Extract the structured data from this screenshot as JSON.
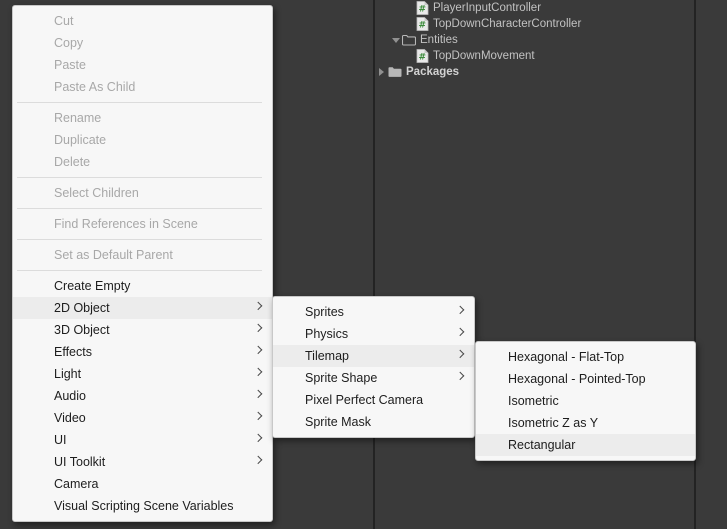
{
  "project_tree": {
    "rows": [
      {
        "label": "PlayerInputController",
        "icon": "csharp-script-icon",
        "indent": 2,
        "twisty": "none",
        "bold": false
      },
      {
        "label": "TopDownCharacterController",
        "icon": "csharp-script-icon",
        "indent": 2,
        "twisty": "none",
        "bold": false
      },
      {
        "label": "Entities",
        "icon": "folder-open-icon",
        "indent": 1,
        "twisty": "expanded",
        "bold": false
      },
      {
        "label": "TopDownMovement",
        "icon": "csharp-script-icon",
        "indent": 2,
        "twisty": "none",
        "bold": false
      },
      {
        "label": "Packages",
        "icon": "folder-icon",
        "indent": 0,
        "twisty": "collapsed",
        "bold": true
      }
    ]
  },
  "menus": {
    "create_menu": {
      "name": "GameObject context menu",
      "items": [
        {
          "label": "Cut",
          "disabled": true,
          "submenu": false,
          "highlight": false
        },
        {
          "label": "Copy",
          "disabled": true,
          "submenu": false,
          "highlight": false
        },
        {
          "label": "Paste",
          "disabled": true,
          "submenu": false,
          "highlight": false
        },
        {
          "label": "Paste As Child",
          "disabled": true,
          "submenu": false,
          "highlight": false
        },
        {
          "separator": true
        },
        {
          "label": "Rename",
          "disabled": true,
          "submenu": false,
          "highlight": false
        },
        {
          "label": "Duplicate",
          "disabled": true,
          "submenu": false,
          "highlight": false
        },
        {
          "label": "Delete",
          "disabled": true,
          "submenu": false,
          "highlight": false
        },
        {
          "separator": true
        },
        {
          "label": "Select Children",
          "disabled": true,
          "submenu": false,
          "highlight": false
        },
        {
          "separator": true
        },
        {
          "label": "Find References in Scene",
          "disabled": true,
          "submenu": false,
          "highlight": false
        },
        {
          "separator": true
        },
        {
          "label": "Set as Default Parent",
          "disabled": true,
          "submenu": false,
          "highlight": false
        },
        {
          "separator": true
        },
        {
          "label": "Create Empty",
          "disabled": false,
          "submenu": false,
          "highlight": false
        },
        {
          "label": "2D Object",
          "disabled": false,
          "submenu": true,
          "highlight": true
        },
        {
          "label": "3D Object",
          "disabled": false,
          "submenu": true,
          "highlight": false
        },
        {
          "label": "Effects",
          "disabled": false,
          "submenu": true,
          "highlight": false
        },
        {
          "label": "Light",
          "disabled": false,
          "submenu": true,
          "highlight": false
        },
        {
          "label": "Audio",
          "disabled": false,
          "submenu": true,
          "highlight": false
        },
        {
          "label": "Video",
          "disabled": false,
          "submenu": true,
          "highlight": false
        },
        {
          "label": "UI",
          "disabled": false,
          "submenu": true,
          "highlight": false
        },
        {
          "label": "UI Toolkit",
          "disabled": false,
          "submenu": true,
          "highlight": false
        },
        {
          "label": "Camera",
          "disabled": false,
          "submenu": false,
          "highlight": false
        },
        {
          "label": "Visual Scripting Scene Variables",
          "disabled": false,
          "submenu": false,
          "highlight": false
        }
      ]
    },
    "two_d_object_menu": {
      "name": "2D Object submenu",
      "items": [
        {
          "label": "Sprites",
          "disabled": false,
          "submenu": true,
          "highlight": false
        },
        {
          "label": "Physics",
          "disabled": false,
          "submenu": true,
          "highlight": false
        },
        {
          "label": "Tilemap",
          "disabled": false,
          "submenu": true,
          "highlight": true
        },
        {
          "label": "Sprite Shape",
          "disabled": false,
          "submenu": true,
          "highlight": false
        },
        {
          "label": "Pixel Perfect Camera",
          "disabled": false,
          "submenu": false,
          "highlight": false
        },
        {
          "label": "Sprite Mask",
          "disabled": false,
          "submenu": false,
          "highlight": false
        }
      ]
    },
    "tilemap_menu": {
      "name": "Tilemap submenu",
      "items": [
        {
          "label": "Hexagonal - Flat-Top",
          "disabled": false,
          "submenu": false,
          "highlight": false
        },
        {
          "label": "Hexagonal - Pointed-Top",
          "disabled": false,
          "submenu": false,
          "highlight": false
        },
        {
          "label": "Isometric",
          "disabled": false,
          "submenu": false,
          "highlight": false
        },
        {
          "label": "Isometric Z as Y",
          "disabled": false,
          "submenu": false,
          "highlight": false
        },
        {
          "label": "Rectangular",
          "disabled": false,
          "submenu": false,
          "highlight": true
        }
      ]
    }
  },
  "colors": {
    "editor_background": "#3a3a3a",
    "panel_divider": "#232323",
    "menu_background": "#f7f7f7",
    "menu_highlight": "#ececec",
    "menu_text": "#1d1d1d",
    "menu_text_disabled": "#a8a8a8",
    "tree_text": "#c2c2c2",
    "script_icon_accent": "#3c8c3c",
    "folder_icon": "#b7b7b7"
  }
}
